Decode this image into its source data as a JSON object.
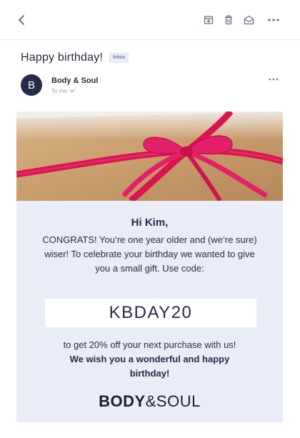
{
  "toolbar": {
    "back_icon": "chevron-left-icon",
    "archive_icon": "archive-icon",
    "trash_icon": "trash-icon",
    "mark_icon": "envelope-open-icon",
    "more_icon": "more-horizontal-icon"
  },
  "message": {
    "subject": "Happy birthday!",
    "folder_badge": "Inbox",
    "sender_initial": "B",
    "sender_name": "Body & Soul",
    "recipient": "To me",
    "accent_color": "#262b4a"
  },
  "email": {
    "greeting": "Hi Kim,",
    "paragraph": "CONGRATS! You’re one year older and (we’re sure) wiser! To celebrate your birthday we wanted to give you a small gift. Use code:",
    "code": "KBDAY20",
    "offer": "to get 20% off your next purchase with us!",
    "wish": "We wish you a wonderful and happy birthday!",
    "logo_bold": "BODY",
    "logo_light": "&SOUL",
    "background_color": "#e9edf7",
    "ribbon_color": "#e0185a"
  }
}
